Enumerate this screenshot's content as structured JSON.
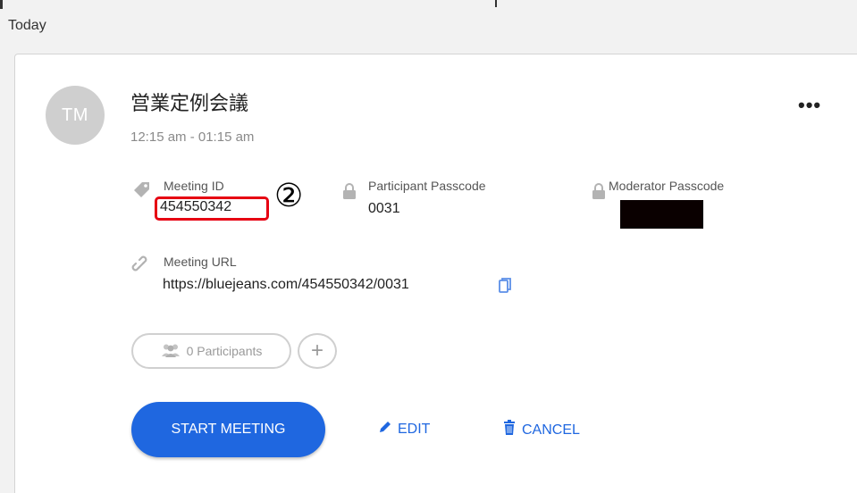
{
  "section": {
    "day_label": "Today"
  },
  "meeting": {
    "avatar_initials": "TM",
    "title": "営業定例会議",
    "time": "12:15 am - 01:15 am",
    "more_label": "•••",
    "meeting_id_label": "Meeting ID",
    "meeting_id": "454550342",
    "participant_passcode_label": "Participant Passcode",
    "participant_passcode": "0031",
    "moderator_passcode_label": "Moderator Passcode",
    "meeting_url_label": "Meeting URL",
    "meeting_url": "https://bluejeans.com/454550342/0031"
  },
  "annotation": {
    "marker": "②",
    "color": "#e60012"
  },
  "participants": {
    "label": "0 Participants",
    "add_label": "+"
  },
  "actions": {
    "start_label": "START MEETING",
    "edit_label": "EDIT",
    "cancel_label": "CANCEL"
  },
  "colors": {
    "accent": "#1f67e0",
    "avatar": "#cfcfcf"
  },
  "icons": [
    "tag-icon",
    "lock-icon",
    "link-icon",
    "copy-icon",
    "people-icon",
    "pencil-icon",
    "trash-icon"
  ]
}
